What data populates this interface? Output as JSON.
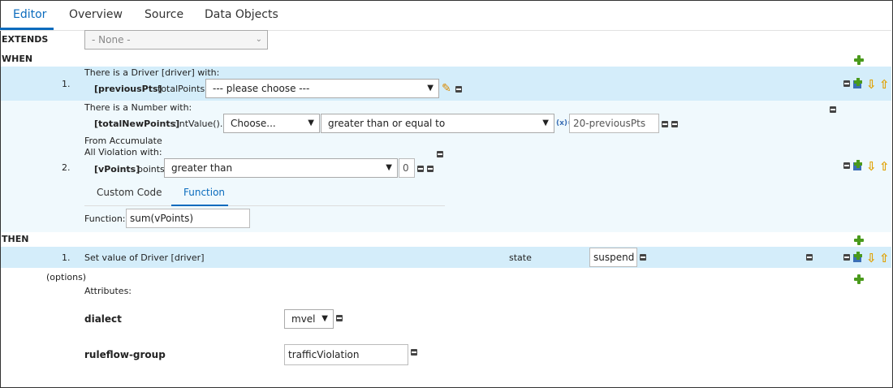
{
  "tabs": [
    {
      "label": "Editor",
      "active": true
    },
    {
      "label": "Overview",
      "active": false
    },
    {
      "label": "Source",
      "active": false
    },
    {
      "label": "Data Objects",
      "active": false
    }
  ],
  "extends": {
    "label": "EXTENDS",
    "value": "- None -"
  },
  "when": {
    "label": "WHEN",
    "row1": {
      "index": "1.",
      "line1": "There is a Driver [driver] with:",
      "binding": "[previousPts]",
      "field": "totalPoints",
      "select": "--- please choose ---"
    },
    "row2": {
      "index": "2.",
      "line1": "There is a Number with:",
      "binding": "[totalNewPoints]",
      "field": ":intValue().",
      "choose_select": "Choose...",
      "operator_select": "greater than or equal to",
      "formula_badge": "(x)=",
      "value": "20-previousPts",
      "from_accumulate": "From Accumulate",
      "all_violation": "All Violation with:",
      "vpoints_binding": "[vPoints]",
      "vpoints_field": "points",
      "vpoints_operator": "greater than",
      "vpoints_value": "0",
      "subtabs": [
        "Custom Code",
        "Function"
      ],
      "function_label": "Function:",
      "function_value": "sum(vPoints)"
    }
  },
  "then": {
    "label": "THEN",
    "row1": {
      "index": "1.",
      "text": "Set value of Driver [driver]",
      "field": "state",
      "value": "suspend"
    }
  },
  "options": {
    "label": "(options)",
    "attributes_label": "Attributes:",
    "dialect": {
      "label": "dialect",
      "value": "mvel"
    },
    "ruleflow": {
      "label": "ruleflow-group",
      "value": "trafficViolation"
    }
  },
  "colors": {
    "accent": "#0a6bbd",
    "row_highlight": "#d4edfa",
    "row_light": "#f0f9fd",
    "plus_green": "#4a9a1c",
    "arrow_orange": "#e0a000"
  }
}
